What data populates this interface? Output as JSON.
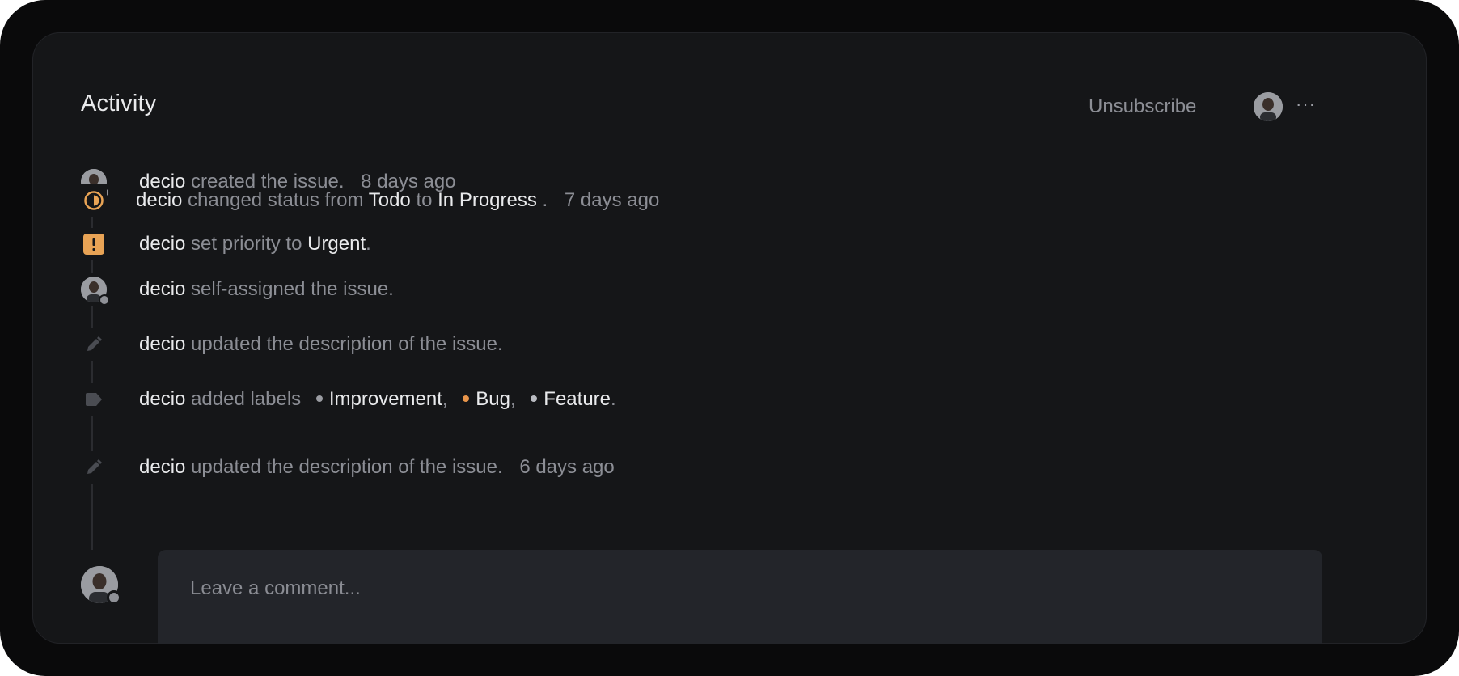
{
  "header": {
    "title": "Activity",
    "unsubscribe_label": "Unsubscribe",
    "more_label": "···"
  },
  "activity": {
    "items": [
      {
        "actor": "decio",
        "text": "created the issue.",
        "time": "8 days ago",
        "icon": "user-avatar"
      },
      {
        "actor": "decio",
        "text": "changed status from",
        "from": "Todo",
        "to_word": "to",
        "to": "In Progress",
        "end": ".",
        "time": "7 days ago",
        "icon": "in-progress-icon"
      },
      {
        "actor": "decio",
        "text": "set priority to",
        "value": "Urgent",
        "end": ".",
        "icon": "urgent-priority-icon"
      },
      {
        "actor": "decio",
        "text": "self-assigned the issue.",
        "icon": "user-avatar"
      },
      {
        "actor": "decio",
        "text": "updated the description of the issue.",
        "icon": "pencil-icon"
      },
      {
        "actor": "decio",
        "text": "added labels",
        "labels": [
          {
            "name": "Improvement",
            "sep": ","
          },
          {
            "name": "Bug",
            "sep": ","
          },
          {
            "name": "Feature",
            "sep": "."
          }
        ],
        "icon": "tag-icon"
      },
      {
        "actor": "decio",
        "text": "updated the description of the issue.",
        "time": "6 days ago",
        "icon": "pencil-icon"
      }
    ]
  },
  "comment": {
    "placeholder": "Leave a comment..."
  },
  "colors": {
    "accent_orange": "#e8a355",
    "label_improvement": "#9a9ca2",
    "label_bug": "#e8954a",
    "label_feature": "#b9bbc1"
  }
}
